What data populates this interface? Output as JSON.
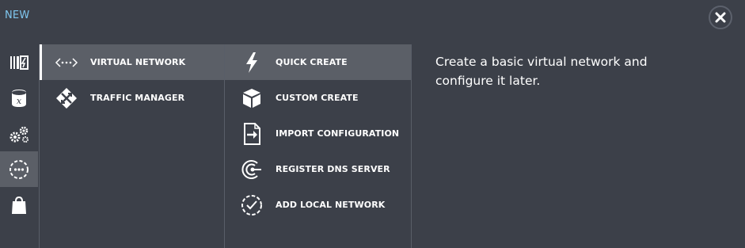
{
  "header": {
    "title": "NEW"
  },
  "rail": {
    "items": [
      {
        "icon": "storage-bars-icon"
      },
      {
        "icon": "sql-database-icon"
      },
      {
        "icon": "cloud-services-gears-icon"
      },
      {
        "icon": "networks-icon",
        "active": true
      },
      {
        "icon": "store-bag-icon"
      }
    ]
  },
  "categories": [
    {
      "label": "VIRTUAL NETWORK",
      "icon": "virtual-network-icon",
      "selected": true
    },
    {
      "label": "TRAFFIC MANAGER",
      "icon": "traffic-manager-icon"
    }
  ],
  "actions": [
    {
      "label": "QUICK CREATE",
      "icon": "lightning-icon",
      "selected": true
    },
    {
      "label": "CUSTOM CREATE",
      "icon": "box-icon"
    },
    {
      "label": "IMPORT CONFIGURATION",
      "icon": "import-file-icon"
    },
    {
      "label": "REGISTER DNS SERVER",
      "icon": "dns-server-icon"
    },
    {
      "label": "ADD LOCAL NETWORK",
      "icon": "local-network-icon"
    }
  ],
  "description": "Create a basic virtual network and configure it later.",
  "colors": {
    "background": "#3c4049",
    "selected": "#5b5f67",
    "title": "#7fc6ee",
    "divider": "#595e68"
  }
}
